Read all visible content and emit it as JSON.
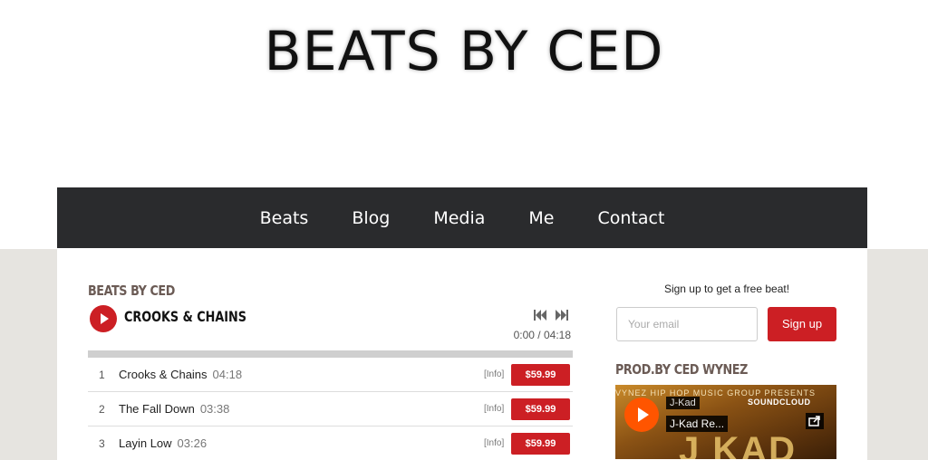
{
  "site": {
    "title": "BEATS BY CED"
  },
  "nav": {
    "items": [
      "Beats",
      "Blog",
      "Media",
      "Me",
      "Contact"
    ]
  },
  "player": {
    "heading": "BEATS BY CED",
    "now_playing": "CROOKS & CHAINS",
    "time": "0:00 / 04:18",
    "progress": 0,
    "tracks": [
      {
        "num": "1",
        "name": "Crooks & Chains",
        "duration": "04:18",
        "info": "[Info]",
        "price": "$59.99"
      },
      {
        "num": "2",
        "name": "The Fall Down",
        "duration": "03:38",
        "info": "[Info]",
        "price": "$59.99"
      },
      {
        "num": "3",
        "name": "Layin Low",
        "duration": "03:26",
        "info": "[Info]",
        "price": "$59.99"
      }
    ]
  },
  "sidebar": {
    "signup_label": "Sign up to get a free beat!",
    "email_placeholder": "Your email",
    "signup_button": "Sign up",
    "prod_heading": "PROD.BY CED WYNEZ",
    "soundcloud": {
      "user": "J-Kad",
      "track": "J-Kad Re...",
      "logo": "SOUNDCLOUD",
      "band_text": "VYNEZ HIP HOP MUSIC GROUP PRESENTS",
      "art_text": "J KAD"
    }
  },
  "colors": {
    "accent": "#cc1f24",
    "nav_bg": "#2a2b2d",
    "soundcloud": "#ff5500"
  }
}
